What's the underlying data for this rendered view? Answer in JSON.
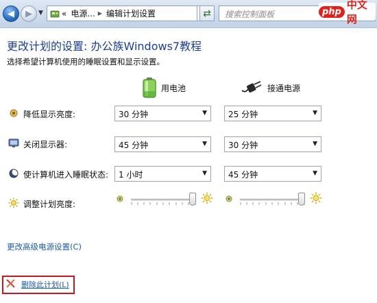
{
  "navbar": {
    "breadcrumb": {
      "prefix": "«",
      "items": [
        "电源...",
        "编辑计划设置"
      ]
    },
    "search_placeholder": "搜索控制面板"
  },
  "watermark": {
    "logo": "php",
    "text": "中文网"
  },
  "page": {
    "title": "更改计划的设置: 办公族Windows7教程",
    "subtitle": "选择希望计算机使用的睡眠设置和显示设置。"
  },
  "columns": {
    "battery": "用电池",
    "plugged_in": "接通电源"
  },
  "settings": [
    {
      "label": "降低显示亮度:",
      "battery": "30 分钟",
      "plugged_in": "25 分钟"
    },
    {
      "label": "关闭显示器:",
      "battery": "45 分钟",
      "plugged_in": "30 分钟"
    },
    {
      "label": "使计算机进入睡眠状态:",
      "battery": "1 小时",
      "plugged_in": "45 分钟"
    }
  ],
  "brightness": {
    "label": "调整计划亮度:",
    "battery_level": 0.95,
    "plugged_in_level": 0.95
  },
  "links": {
    "advanced": "更改高级电源设置(C)",
    "delete": "删除此计划(L)"
  },
  "colors": {
    "title_blue": "#1b3f95",
    "link_blue": "#1d5aa8",
    "highlight_red": "#c8161c"
  }
}
